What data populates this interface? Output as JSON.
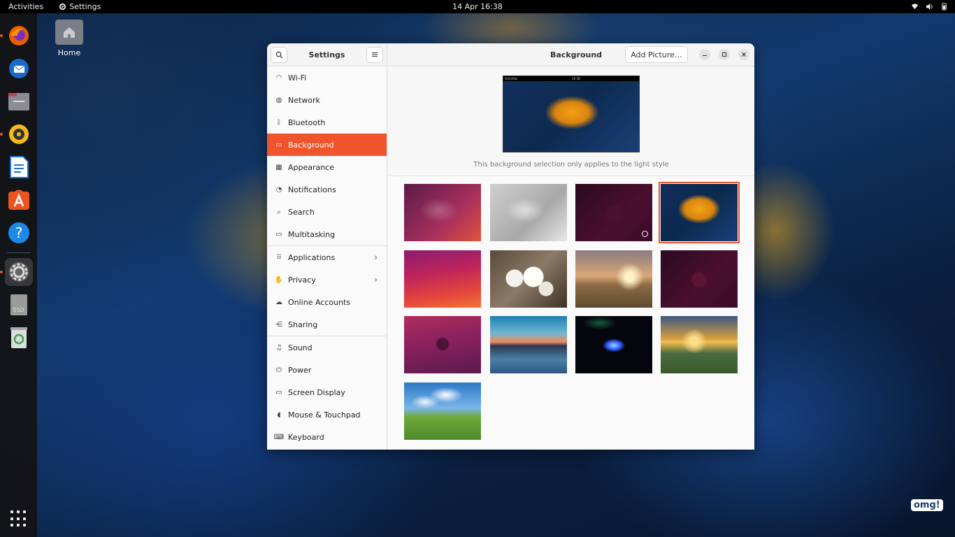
{
  "topbar": {
    "activities": "Activities",
    "app_menu": "Settings",
    "clock": "14 Apr  16:38"
  },
  "desktop": {
    "home_label": "Home",
    "watermark": "omg!"
  },
  "dock": {
    "items": [
      "firefox-icon",
      "thunderbird-icon",
      "files-icon",
      "rhythmbox-icon",
      "libreoffice-writer-icon",
      "app-center-icon",
      "help-icon",
      "settings-icon",
      "ssd-drive-icon",
      "trash-icon"
    ],
    "ssd_label": "SSD"
  },
  "settings": {
    "sidebar_title": "Settings",
    "content_title": "Background",
    "add_picture": "Add Picture…",
    "preview_note": "This background selection only applies to the light style",
    "preview_bar_left": "Activities",
    "preview_bar_clock": "16:38",
    "nav": [
      {
        "label": "Wi-Fi",
        "icon": "wifi-icon"
      },
      {
        "label": "Network",
        "icon": "globe-icon"
      },
      {
        "label": "Bluetooth",
        "icon": "bluetooth-icon"
      },
      {
        "label": "Background",
        "icon": "monitor-icon",
        "selected": true
      },
      {
        "label": "Appearance",
        "icon": "appearance-icon"
      },
      {
        "label": "Notifications",
        "icon": "bell-icon"
      },
      {
        "label": "Search",
        "icon": "search-icon"
      },
      {
        "label": "Multitasking",
        "icon": "multitasking-icon"
      },
      {
        "label": "Applications",
        "icon": "apps-icon",
        "chevron": true
      },
      {
        "label": "Privacy",
        "icon": "hand-icon",
        "chevron": true
      },
      {
        "label": "Online Accounts",
        "icon": "cloud-icon"
      },
      {
        "label": "Sharing",
        "icon": "share-icon"
      },
      {
        "label": "Sound",
        "icon": "music-note-icon"
      },
      {
        "label": "Power",
        "icon": "power-icon"
      },
      {
        "label": "Screen Display",
        "icon": "display-icon"
      },
      {
        "label": "Mouse & Touchpad",
        "icon": "mouse-icon"
      },
      {
        "label": "Keyboard",
        "icon": "keyboard-icon"
      }
    ],
    "accent_color": "#f0542c",
    "selected_wallpaper_index": 3
  }
}
